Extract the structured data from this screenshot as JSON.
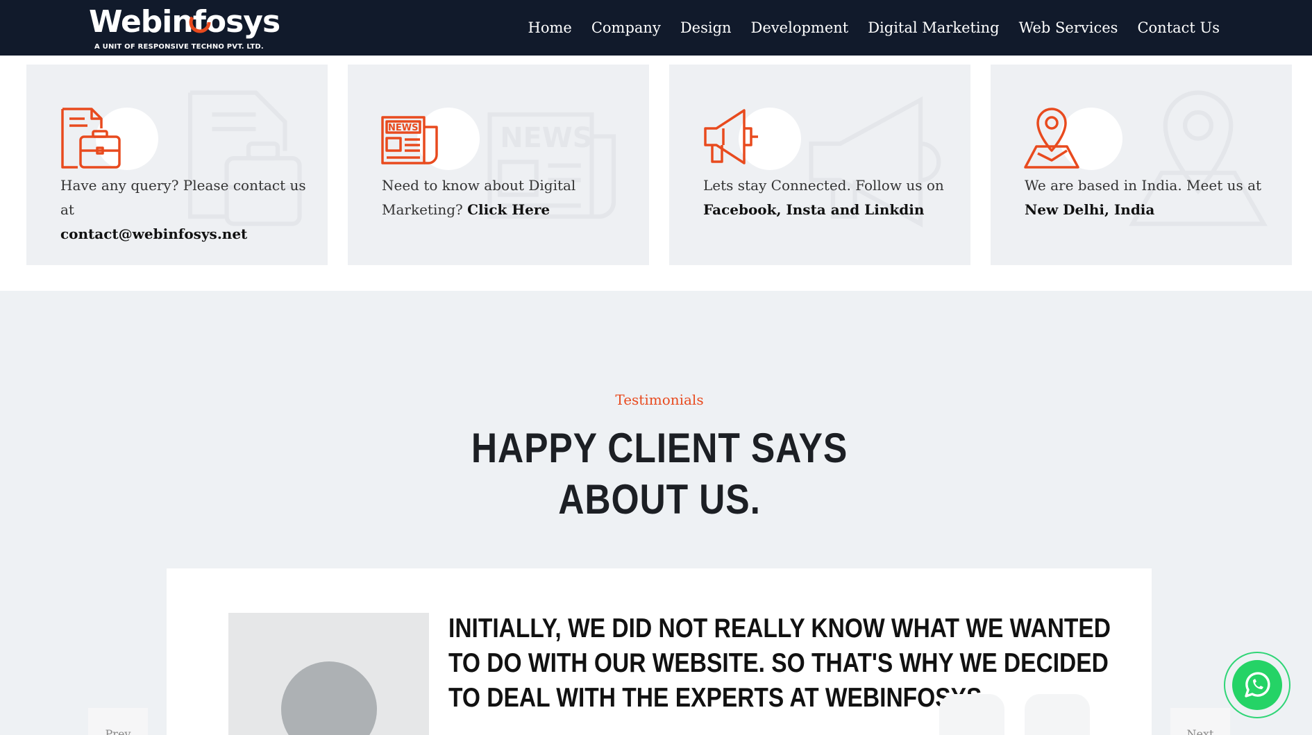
{
  "header": {
    "logo_text": "Webinfosys",
    "logo_subtitle": "A UNIT OF RESPONSIVE TECHNO PVT. LTD.",
    "nav": [
      "Home",
      "Company",
      "Design",
      "Development",
      "Digital Marketing",
      "Web Services",
      "Contact Us"
    ]
  },
  "cards": [
    {
      "icon": "briefcase-document-icon",
      "text": "Have any query? Please contact us at",
      "bold": "contact@webinfosys.net"
    },
    {
      "icon": "newspaper-icon",
      "text": "Need to know about Digital Marketing?",
      "bold": "Click Here"
    },
    {
      "icon": "megaphone-icon",
      "text": "Lets stay Connected. Follow us on",
      "bold": "Facebook, Insta and Linkdin"
    },
    {
      "icon": "map-pin-icon",
      "text": "We are based in India. Meet us at",
      "bold": "New Delhi, India"
    }
  ],
  "testimonials": {
    "kicker": "Testimonials",
    "heading_line1": "HAPPY CLIENT SAYS",
    "heading_line2": "ABOUT US.",
    "quote": "INITIALLY, WE DID NOT REALLY KNOW WHAT WE WANTED TO DO WITH OUR WEBSITE. SO THAT'S WHY WE DECIDED TO DEAL WITH THE EXPERTS AT WEBINFOSYS",
    "prev_label": "Prev",
    "next_label": "Next"
  },
  "colors": {
    "header_bg": "#111a2b",
    "accent": "#e84a1e",
    "section_bg": "#eef1f4",
    "whatsapp": "#25d366"
  }
}
